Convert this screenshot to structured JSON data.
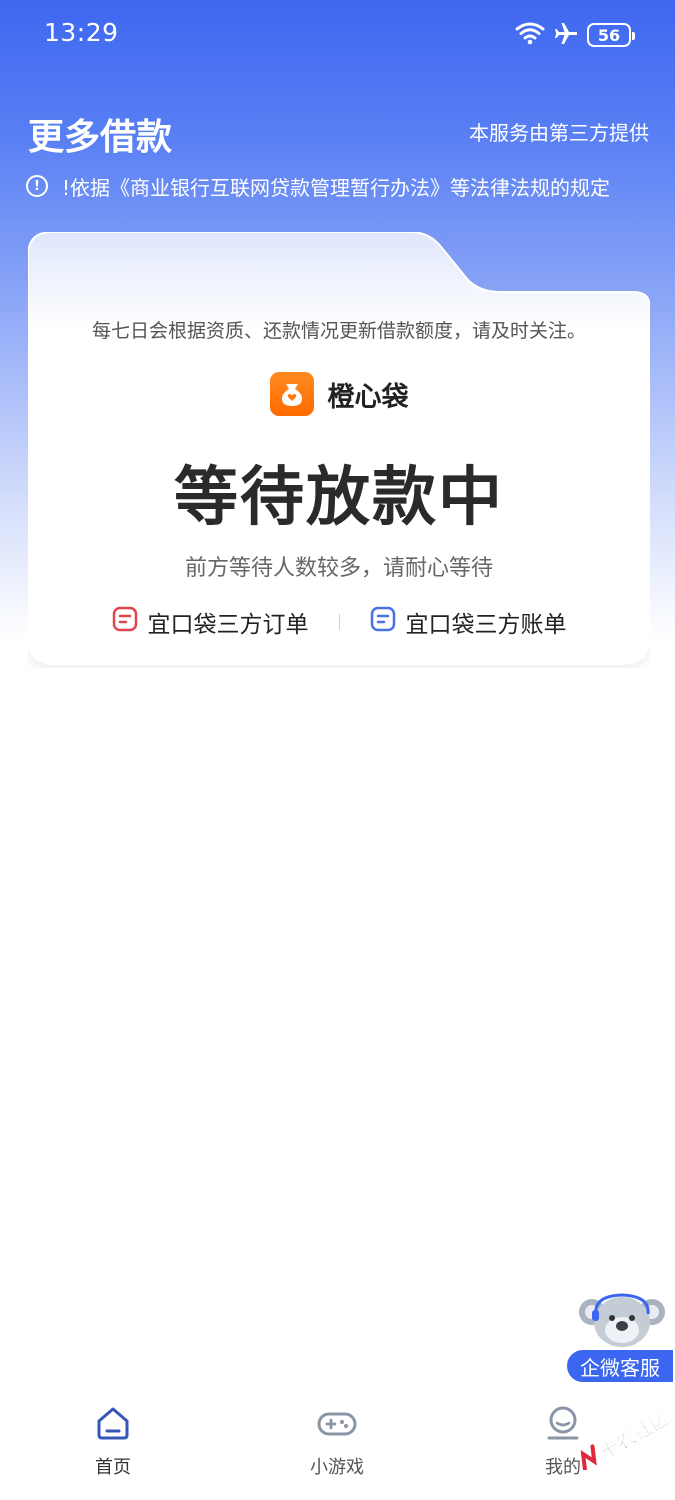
{
  "status_bar": {
    "time": "13:29",
    "battery": "56"
  },
  "header": {
    "title": "更多借款",
    "provider_note": "本服务由第三方提供",
    "notice": "!依据《商业银行互联网贷款管理暂行办法》等法律法规的规定"
  },
  "card": {
    "hint": "每七日会根据资质、还款情况更新借款额度，请及时关注。",
    "brand_name": "橙心袋",
    "status_title": "等待放款中",
    "status_subtitle": "前方等待人数较多，请耐心等待",
    "link_orders": "宜口袋三方订单",
    "link_bills": "宜口袋三方账单"
  },
  "floating_service": {
    "label": "企微客服"
  },
  "tabbar": {
    "tabs": [
      {
        "label": "首页",
        "icon": "home-icon",
        "active": true
      },
      {
        "label": "小游戏",
        "icon": "gamepad-icon",
        "active": false
      },
      {
        "label": "我的",
        "icon": "profile-icon",
        "active": false
      }
    ]
  },
  "watermark": {
    "text": "卡农社区"
  },
  "colors": {
    "accent": "#3a66f0",
    "brand_orange": "#ff7a10",
    "orders_icon": "#e0454b",
    "bills_icon": "#4a72e8"
  }
}
